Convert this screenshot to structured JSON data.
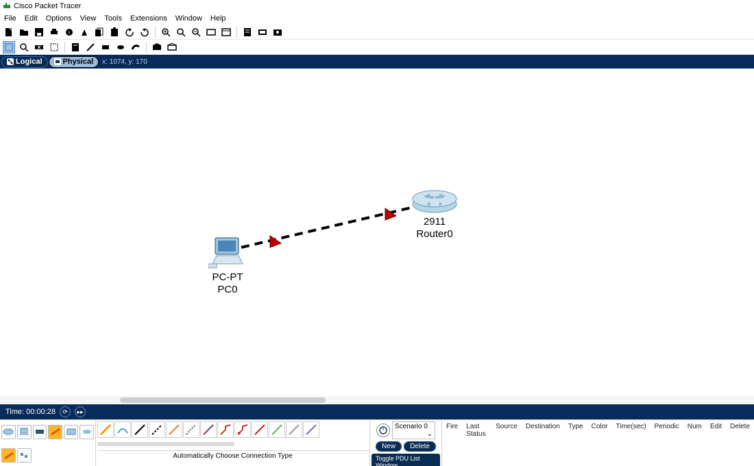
{
  "title": "Cisco Packet Tracer",
  "menu": {
    "file": "File",
    "edit": "Edit",
    "options": "Options",
    "view": "View",
    "tools": "Tools",
    "extensions": "Extensions",
    "window": "Window",
    "help": "Help"
  },
  "viewbar": {
    "logical": "Logical",
    "physical": "Physical",
    "coords": "x: 1074, y: 170"
  },
  "topology": {
    "pc": {
      "model": "PC-PT",
      "name": "PC0"
    },
    "router": {
      "model": "2911",
      "name": "Router0"
    }
  },
  "status": {
    "time": "Time: 00:00:28"
  },
  "scenario": {
    "selected": "Scenario 0",
    "new": "New",
    "delete": "Delete",
    "toggle": "Toggle PDU List Window"
  },
  "pdu_headers": {
    "fire": "Fire",
    "last_status": "Last Status",
    "source": "Source",
    "destination": "Destination",
    "type": "Type",
    "color": "Color",
    "time": "Time(sec)",
    "periodic": "Periodic",
    "num": "Num",
    "edit": "Edit",
    "delete": "Delete"
  },
  "bottom": {
    "conn_label": "Automatically Choose Connection Type"
  }
}
